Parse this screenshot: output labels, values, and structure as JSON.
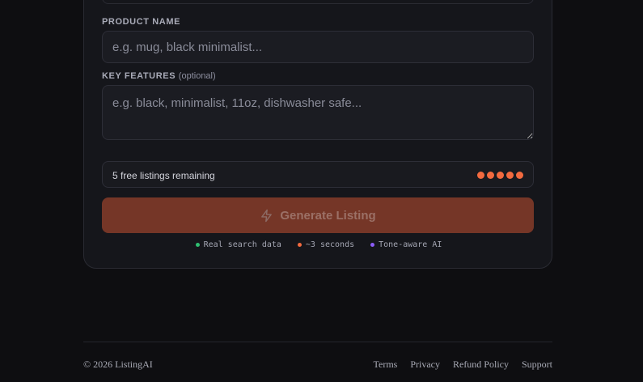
{
  "form": {
    "product_name": {
      "label": "PRODUCT NAME",
      "placeholder": "e.g. mug, black minimalist...",
      "value": ""
    },
    "key_features": {
      "label": "KEY FEATURES",
      "optional_note": "(optional)",
      "placeholder": "e.g. black, minimalist, 11oz, dishwasher safe...",
      "value": ""
    },
    "remaining": {
      "text": "5 free listings remaining",
      "count": 5,
      "dot_color": "#f26a3f"
    },
    "generate_button": {
      "label": "Generate Listing",
      "icon": "lightning-icon",
      "color": "#753627",
      "disabled": true
    },
    "features": [
      {
        "label": "Real search data",
        "color": "#2fbf71"
      },
      {
        "label": "~3 seconds",
        "color": "#f26a3f"
      },
      {
        "label": "Tone-aware AI",
        "color": "#8b5cf6"
      }
    ]
  },
  "footer": {
    "copyright": "© 2026 ListingAI",
    "links": [
      "Terms",
      "Privacy",
      "Refund Policy",
      "Support"
    ]
  }
}
